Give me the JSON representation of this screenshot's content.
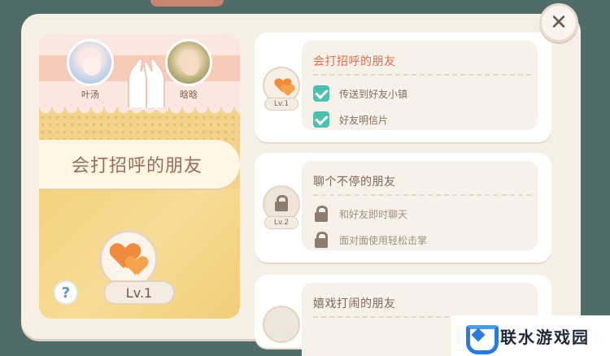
{
  "close_button": {
    "label": "✕"
  },
  "left_card": {
    "friend_1": {
      "name": "叶汤"
    },
    "friend_2": {
      "name": "晗晗"
    },
    "relationship_title": "会打招呼的朋友",
    "level_label": "Lv.1",
    "help_label": "?"
  },
  "levels": [
    {
      "title": "会打招呼的朋友",
      "level_label": "Lv.1",
      "status": "unlocked",
      "perks": [
        {
          "label": "传送到好友小镇",
          "state": "checked"
        },
        {
          "label": "好友明信片",
          "state": "checked"
        }
      ]
    },
    {
      "title": "聊个不停的朋友",
      "level_label": "Lv.2",
      "status": "locked",
      "perks": [
        {
          "label": "和好友即时聊天",
          "state": "locked"
        },
        {
          "label": "面对面使用轻松击掌",
          "state": "locked"
        }
      ]
    },
    {
      "title": "嬉戏打闹的朋友",
      "status": "locked"
    }
  ],
  "watermark": {
    "text": "联水游戏园"
  },
  "colors": {
    "background": "#4f6b6a",
    "panel": "#f6efe6",
    "accent_title": "#e06f4a",
    "check": "#49c2b1",
    "heart": "#f08a3c",
    "left_card": "#f3d38a"
  }
}
